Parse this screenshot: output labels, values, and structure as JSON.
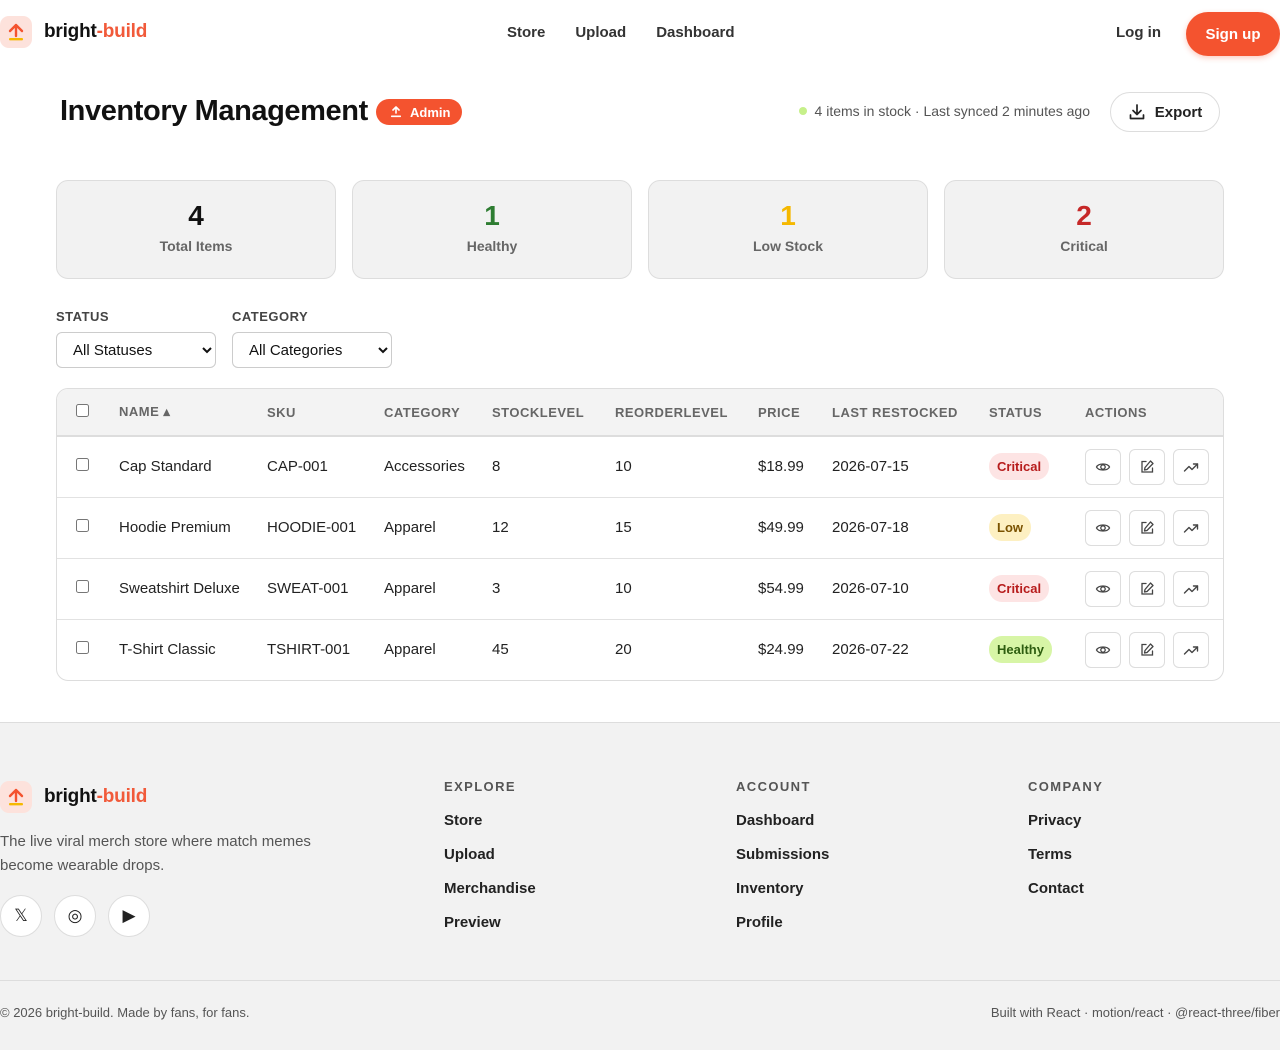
{
  "brand": {
    "part1": "bright",
    "part2": "-build",
    "accent": "#f15a3a"
  },
  "nav": [
    "Store",
    "Upload",
    "Dashboard"
  ],
  "auth": {
    "login": "Log in",
    "signup": "Sign up"
  },
  "page": {
    "title": "Inventory Management",
    "badge": "Admin",
    "status_text": "4 items in stock · Last synced 2 minutes ago",
    "export_label": "Export"
  },
  "stats": [
    {
      "value": "4",
      "label": "Total Items",
      "color": "#111111"
    },
    {
      "value": "1",
      "label": "Healthy",
      "color": "#2e7d32"
    },
    {
      "value": "1",
      "label": "Low Stock",
      "color": "#f5b800"
    },
    {
      "value": "2",
      "label": "Critical",
      "color": "#c62828"
    }
  ],
  "filters": {
    "status": {
      "label": "STATUS",
      "selected": "All Statuses"
    },
    "category": {
      "label": "CATEGORY",
      "selected": "All Categories"
    }
  },
  "table": {
    "headers": {
      "name": "NAME ▴",
      "sku": "SKU",
      "category": "CATEGORY",
      "stock": "STOCKLEVEL",
      "reorder": "REORDERLEVEL",
      "price": "PRICE",
      "restocked": "LAST RESTOCKED",
      "status": "STATUS",
      "actions": "ACTIONS"
    },
    "rows": [
      {
        "name": "Cap Standard",
        "sku": "CAP-001",
        "category": "Accessories",
        "stock": "8",
        "reorder": "10",
        "price": "$18.99",
        "restocked": "2026-07-15",
        "status": "Critical"
      },
      {
        "name": "Hoodie Premium",
        "sku": "HOODIE-001",
        "category": "Apparel",
        "stock": "12",
        "reorder": "15",
        "price": "$49.99",
        "restocked": "2026-07-18",
        "status": "Low"
      },
      {
        "name": "Sweatshirt Deluxe",
        "sku": "SWEAT-001",
        "category": "Apparel",
        "stock": "3",
        "reorder": "10",
        "price": "$54.99",
        "restocked": "2026-07-10",
        "status": "Critical"
      },
      {
        "name": "T-Shirt Classic",
        "sku": "TSHIRT-001",
        "category": "Apparel",
        "stock": "45",
        "reorder": "20",
        "price": "$24.99",
        "restocked": "2026-07-22",
        "status": "Healthy"
      }
    ],
    "row_actions": [
      "eye-icon",
      "edit-icon",
      "trending-up-icon"
    ]
  },
  "status_colors": {
    "Critical": {
      "bg": "#fde4e4",
      "fg": "#b71c1c"
    },
    "Low": {
      "bg": "#fdf0c2",
      "fg": "#7a5200"
    },
    "Healthy": {
      "bg": "#d7f5a6",
      "fg": "#2e5e10"
    }
  },
  "footer": {
    "tagline": "The live viral merch store where match memes become wearable drops.",
    "social_icons": [
      "x-icon",
      "instagram-icon",
      "youtube-icon"
    ],
    "columns": [
      {
        "title": "EXPLORE",
        "links": [
          "Store",
          "Upload",
          "Merchandise",
          "Preview"
        ]
      },
      {
        "title": "ACCOUNT",
        "links": [
          "Dashboard",
          "Submissions",
          "Inventory",
          "Profile"
        ]
      },
      {
        "title": "COMPANY",
        "links": [
          "Privacy",
          "Terms",
          "Contact"
        ]
      }
    ],
    "copyright": "© 2026 bright-build. Made by fans, for fans.",
    "built_with": "Built with React · motion/react · @react-three/fiber"
  }
}
